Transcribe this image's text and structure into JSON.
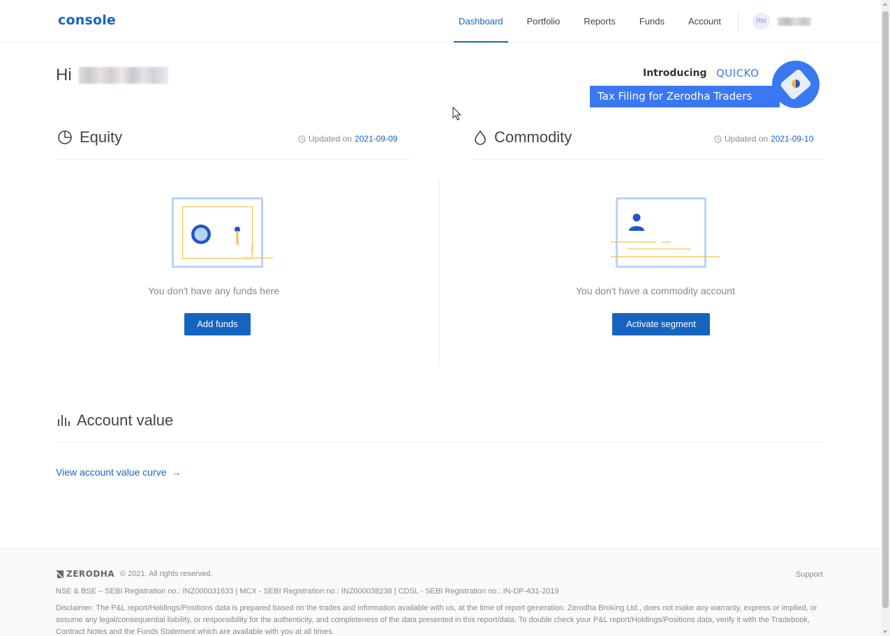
{
  "header": {
    "logo": "console",
    "nav": [
      {
        "label": "Dashboard",
        "active": true
      },
      {
        "label": "Portfolio",
        "active": false
      },
      {
        "label": "Reports",
        "active": false
      },
      {
        "label": "Funds",
        "active": false
      },
      {
        "label": "Account",
        "active": false
      }
    ],
    "avatar_initials": "RM"
  },
  "greeting": {
    "prefix": "Hi"
  },
  "banner": {
    "intro": "Introducing",
    "brand": "QUICKO",
    "tagline": "Tax Filing for Zerodha Traders"
  },
  "equity": {
    "title": "Equity",
    "updated_label": "Updated on",
    "updated_date": "2021-09-09",
    "empty_message": "You don't have any funds here",
    "button": "Add funds"
  },
  "commodity": {
    "title": "Commodity",
    "updated_label": "Updated on",
    "updated_date": "2021-09-10",
    "empty_message": "You don't have a commodity account",
    "button": "Activate segment"
  },
  "account_value": {
    "title": "Account value",
    "link": "View account value curve",
    "link_arrow": "→"
  },
  "footer": {
    "brand": "ZERODHA",
    "copyright": "© 2021. All rights reserved.",
    "support": "Support",
    "registration": "NSE & BSE – SEBI Registration no.: INZ000031633 | MCX - SEBI Registration no.: INZ000038238 | CDSL - SEBI Registration no.: IN-DP-431-2019",
    "disclaimer": "Disclaimer: The P&L report/Holdings/Positions data is prepared based on the trades and information available with us, at the time of report generation. Zerodha Broking Ltd., does not make any warranty, express or implied, or assume any legal/consequential liability, or responsibility for the authenticity, and completeness of the data presented in this report/data. To double check your P&L report/Holdings/Positions data, verify it with the Tradebook, Contract Notes and the Funds Statement which are available with you at all times."
  },
  "colors": {
    "accent": "#1565c0",
    "banner_blue": "#3a78f2",
    "illustration_yellow": "#f6c244",
    "illustration_blue": "#b6d4fb"
  }
}
